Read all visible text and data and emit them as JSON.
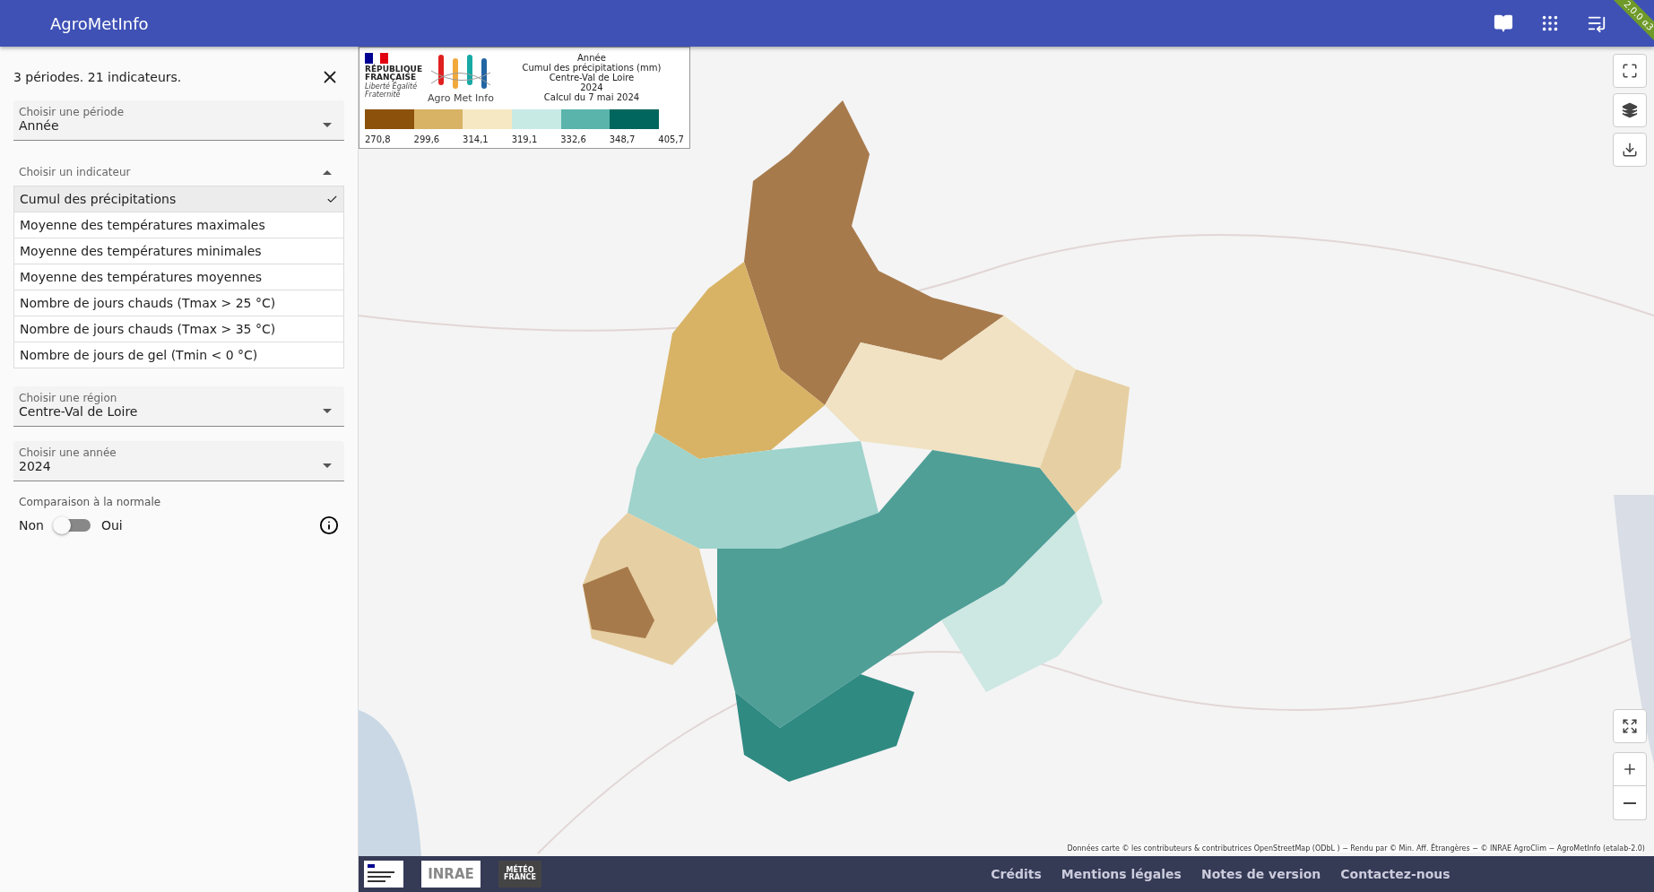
{
  "app_bar": {
    "title": "AgroMetInfo",
    "version": "2.0.0 α3"
  },
  "sidebar": {
    "summary": "3 périodes. 21 indicateurs.",
    "period": {
      "label": "Choisir une période",
      "value": "Année"
    },
    "indicator": {
      "label": "Choisir un indicateur",
      "expanded": true,
      "options": [
        {
          "label": "Cumul des précipitations",
          "selected": true
        },
        {
          "label": "Moyenne des températures maximales",
          "selected": false
        },
        {
          "label": "Moyenne des températures minimales",
          "selected": false
        },
        {
          "label": "Moyenne des températures moyennes",
          "selected": false
        },
        {
          "label": "Nombre de jours chauds (Tmax > 25 °C)",
          "selected": false
        },
        {
          "label": "Nombre de jours chauds (Tmax > 35 °C)",
          "selected": false
        },
        {
          "label": "Nombre de jours de gel (Tmin < 0 °C)",
          "selected": false
        }
      ]
    },
    "region": {
      "label": "Choisir une région",
      "value": "Centre-Val de Loire"
    },
    "year": {
      "label": "Choisir une année",
      "value": "2024"
    },
    "comparison": {
      "label": "Comparaison à la normale",
      "off_label": "Non",
      "on_label": "Oui",
      "on": false
    }
  },
  "legend": {
    "republique": "RÉPUBLIQUE FRANÇAISE",
    "motto": "Liberté Égalité Fraternité",
    "brand": "Agro Met Info",
    "lines": [
      "Année",
      "Cumul des précipitations (mm)",
      "Centre-Val de Loire",
      "2024",
      "Calcul du 7 mai 2024"
    ],
    "bins": [
      {
        "color": "#8c510a"
      },
      {
        "color": "#d8b365"
      },
      {
        "color": "#f6e8c3"
      },
      {
        "color": "#c7eae5"
      },
      {
        "color": "#5ab4ac"
      },
      {
        "color": "#01665e"
      }
    ],
    "ticks": [
      "270,8",
      "299,6",
      "314,1",
      "319,1",
      "332,6",
      "348,7",
      "405,7"
    ]
  },
  "map": {
    "kind": "picture",
    "attribution": "Données carte © les contributeurs & contributrices OpenStreetMap (ODbL ) − Rendu par © Min. Aff. Étrangères − © INRAE AgroClim − AgroMetInfo (etalab-2.0)"
  },
  "footer": {
    "logos": [
      "INRAE",
      "MÉTÉO FRANCE"
    ],
    "links": [
      "Crédits",
      "Mentions légales",
      "Notes de version",
      "Contactez-nous"
    ]
  }
}
